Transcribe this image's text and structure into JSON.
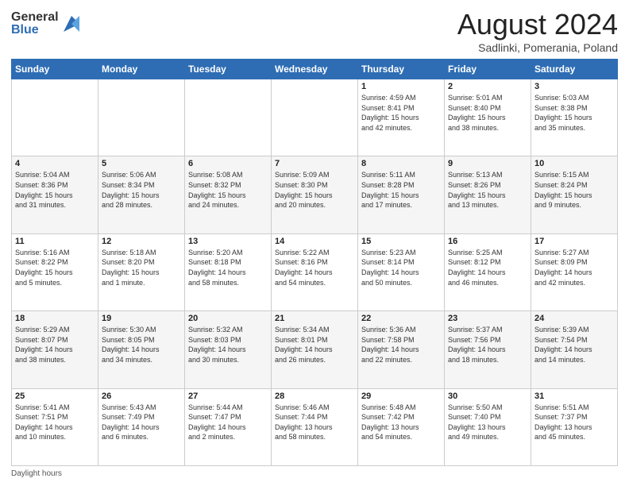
{
  "header": {
    "logo_general": "General",
    "logo_blue": "Blue",
    "month_title": "August 2024",
    "location": "Sadlinki, Pomerania, Poland"
  },
  "weekdays": [
    "Sunday",
    "Monday",
    "Tuesday",
    "Wednesday",
    "Thursday",
    "Friday",
    "Saturday"
  ],
  "weeks": [
    [
      {
        "day": "",
        "info": ""
      },
      {
        "day": "",
        "info": ""
      },
      {
        "day": "",
        "info": ""
      },
      {
        "day": "",
        "info": ""
      },
      {
        "day": "1",
        "info": "Sunrise: 4:59 AM\nSunset: 8:41 PM\nDaylight: 15 hours\nand 42 minutes."
      },
      {
        "day": "2",
        "info": "Sunrise: 5:01 AM\nSunset: 8:40 PM\nDaylight: 15 hours\nand 38 minutes."
      },
      {
        "day": "3",
        "info": "Sunrise: 5:03 AM\nSunset: 8:38 PM\nDaylight: 15 hours\nand 35 minutes."
      }
    ],
    [
      {
        "day": "4",
        "info": "Sunrise: 5:04 AM\nSunset: 8:36 PM\nDaylight: 15 hours\nand 31 minutes."
      },
      {
        "day": "5",
        "info": "Sunrise: 5:06 AM\nSunset: 8:34 PM\nDaylight: 15 hours\nand 28 minutes."
      },
      {
        "day": "6",
        "info": "Sunrise: 5:08 AM\nSunset: 8:32 PM\nDaylight: 15 hours\nand 24 minutes."
      },
      {
        "day": "7",
        "info": "Sunrise: 5:09 AM\nSunset: 8:30 PM\nDaylight: 15 hours\nand 20 minutes."
      },
      {
        "day": "8",
        "info": "Sunrise: 5:11 AM\nSunset: 8:28 PM\nDaylight: 15 hours\nand 17 minutes."
      },
      {
        "day": "9",
        "info": "Sunrise: 5:13 AM\nSunset: 8:26 PM\nDaylight: 15 hours\nand 13 minutes."
      },
      {
        "day": "10",
        "info": "Sunrise: 5:15 AM\nSunset: 8:24 PM\nDaylight: 15 hours\nand 9 minutes."
      }
    ],
    [
      {
        "day": "11",
        "info": "Sunrise: 5:16 AM\nSunset: 8:22 PM\nDaylight: 15 hours\nand 5 minutes."
      },
      {
        "day": "12",
        "info": "Sunrise: 5:18 AM\nSunset: 8:20 PM\nDaylight: 15 hours\nand 1 minute."
      },
      {
        "day": "13",
        "info": "Sunrise: 5:20 AM\nSunset: 8:18 PM\nDaylight: 14 hours\nand 58 minutes."
      },
      {
        "day": "14",
        "info": "Sunrise: 5:22 AM\nSunset: 8:16 PM\nDaylight: 14 hours\nand 54 minutes."
      },
      {
        "day": "15",
        "info": "Sunrise: 5:23 AM\nSunset: 8:14 PM\nDaylight: 14 hours\nand 50 minutes."
      },
      {
        "day": "16",
        "info": "Sunrise: 5:25 AM\nSunset: 8:12 PM\nDaylight: 14 hours\nand 46 minutes."
      },
      {
        "day": "17",
        "info": "Sunrise: 5:27 AM\nSunset: 8:09 PM\nDaylight: 14 hours\nand 42 minutes."
      }
    ],
    [
      {
        "day": "18",
        "info": "Sunrise: 5:29 AM\nSunset: 8:07 PM\nDaylight: 14 hours\nand 38 minutes."
      },
      {
        "day": "19",
        "info": "Sunrise: 5:30 AM\nSunset: 8:05 PM\nDaylight: 14 hours\nand 34 minutes."
      },
      {
        "day": "20",
        "info": "Sunrise: 5:32 AM\nSunset: 8:03 PM\nDaylight: 14 hours\nand 30 minutes."
      },
      {
        "day": "21",
        "info": "Sunrise: 5:34 AM\nSunset: 8:01 PM\nDaylight: 14 hours\nand 26 minutes."
      },
      {
        "day": "22",
        "info": "Sunrise: 5:36 AM\nSunset: 7:58 PM\nDaylight: 14 hours\nand 22 minutes."
      },
      {
        "day": "23",
        "info": "Sunrise: 5:37 AM\nSunset: 7:56 PM\nDaylight: 14 hours\nand 18 minutes."
      },
      {
        "day": "24",
        "info": "Sunrise: 5:39 AM\nSunset: 7:54 PM\nDaylight: 14 hours\nand 14 minutes."
      }
    ],
    [
      {
        "day": "25",
        "info": "Sunrise: 5:41 AM\nSunset: 7:51 PM\nDaylight: 14 hours\nand 10 minutes."
      },
      {
        "day": "26",
        "info": "Sunrise: 5:43 AM\nSunset: 7:49 PM\nDaylight: 14 hours\nand 6 minutes."
      },
      {
        "day": "27",
        "info": "Sunrise: 5:44 AM\nSunset: 7:47 PM\nDaylight: 14 hours\nand 2 minutes."
      },
      {
        "day": "28",
        "info": "Sunrise: 5:46 AM\nSunset: 7:44 PM\nDaylight: 13 hours\nand 58 minutes."
      },
      {
        "day": "29",
        "info": "Sunrise: 5:48 AM\nSunset: 7:42 PM\nDaylight: 13 hours\nand 54 minutes."
      },
      {
        "day": "30",
        "info": "Sunrise: 5:50 AM\nSunset: 7:40 PM\nDaylight: 13 hours\nand 49 minutes."
      },
      {
        "day": "31",
        "info": "Sunrise: 5:51 AM\nSunset: 7:37 PM\nDaylight: 13 hours\nand 45 minutes."
      }
    ]
  ],
  "footer": {
    "note": "Daylight hours"
  }
}
